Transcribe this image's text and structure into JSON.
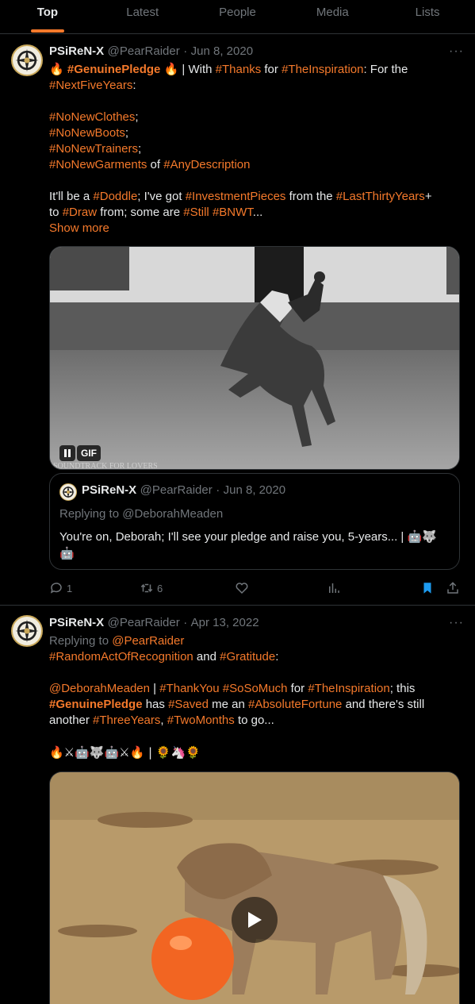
{
  "tabs": [
    "Top",
    "Latest",
    "People",
    "Media",
    "Lists"
  ],
  "tweet1": {
    "name": "PSiReN-X",
    "handle": "@PearRaider",
    "dot": "·",
    "date": "Jun 8, 2020",
    "more": "···",
    "line1": {
      "emoji_a": "🔥",
      "tag_pledge": "#GenuinePledge",
      "emoji_b": "🔥",
      "with": " | With ",
      "tag_thanks": "#Thanks",
      "for": " for ",
      "tag_insp": "#TheInspiration",
      "for_the": ": For the"
    },
    "line2": {
      "tag": "#NextFiveYears",
      "rest": ":"
    },
    "list": [
      {
        "tag": "#NoNewClothes",
        "rest": ";"
      },
      {
        "tag": "#NoNewBoots",
        "rest": ";"
      },
      {
        "tag": "#NoNewTrainers",
        "rest": ";"
      }
    ],
    "list_last": {
      "tag": "#NoNewGarments",
      "of": " of ",
      "tag2": "#AnyDescription"
    },
    "para": {
      "a": "It'll be a ",
      "t1": "#Doddle",
      "b": "; I've got ",
      "t2": "#InvestmentPieces",
      "c": " from the ",
      "t3": "#LastThirtyYears",
      "d": "+",
      "e": "to ",
      "t4": "#Draw",
      "f": " from; some are ",
      "t5": "#Still",
      "g": " ",
      "t6": "#BNWT",
      "h": "..."
    },
    "show_more": "Show more",
    "gif_label": "GIF",
    "gif_caption": "SOUNDTRACK FOR LOVERS",
    "quote": {
      "name": "PSiReN-X",
      "handle": "@PearRaider",
      "dot": "·",
      "date": "Jun 8, 2020",
      "replying": "Replying to @DeborahMeaden",
      "text": "You're on, Deborah; I'll see your pledge and raise you, 5-years... |",
      "emojis": "🤖🐺",
      "emoji2": "🤖"
    },
    "replies": "1",
    "retweets": "6"
  },
  "tweet2": {
    "name": "PSiReN-X",
    "handle": "@PearRaider",
    "dot": "·",
    "date": "Apr 13, 2022",
    "more": "···",
    "replying": "Replying to ",
    "replying_handle": "@PearRaider",
    "l1": {
      "t1": "#RandomActOfRecognition",
      "and": " and ",
      "t2": "#Gratitude",
      "c": ":"
    },
    "l2": {
      "mention": "@DeborahMeaden",
      "sep": " | ",
      "t1": "#ThankYou",
      "sp": " ",
      "t2": "#SoSoMuch",
      "for": " for ",
      "t3": "#TheInspiration",
      "this": "; this"
    },
    "l3": {
      "t1": "#GenuinePledge",
      "has": " has ",
      "t2": "#Saved",
      "me": " me an ",
      "t3": "#AbsoluteFortune",
      "still": " and there's still"
    },
    "l4": {
      "another": "another ",
      "t1": "#ThreeYears",
      "comma": ", ",
      "t2": "#TwoMonths",
      "go": " to go..."
    },
    "emoji_line": "🔥⚔🤖🐺🤖⚔🔥 | 🌻🦄🌻"
  }
}
